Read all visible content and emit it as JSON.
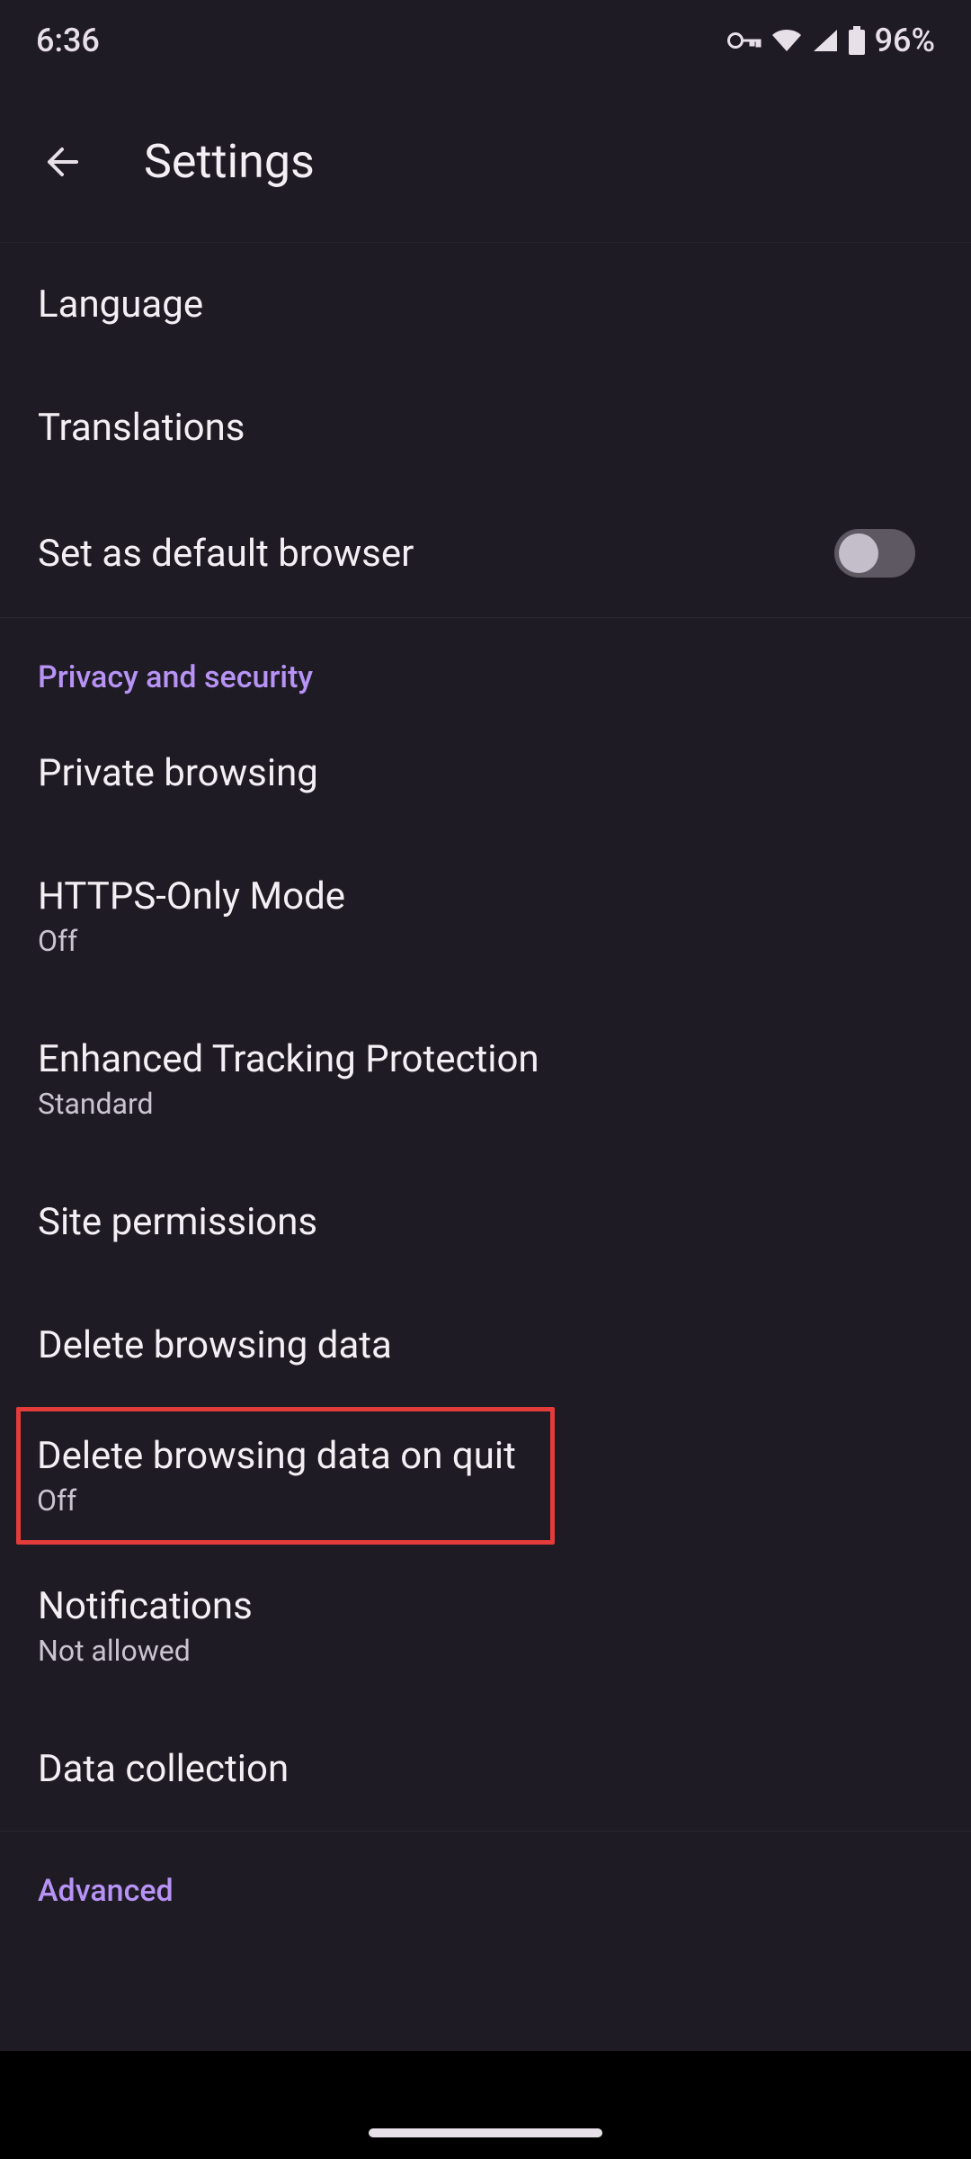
{
  "status": {
    "time": "6:36",
    "battery": "96%"
  },
  "header": {
    "title": "Settings"
  },
  "general": {
    "language": "Language",
    "translations": "Translations",
    "default_browser": "Set as default browser"
  },
  "privacy": {
    "header": "Privacy and security",
    "private_browsing": "Private browsing",
    "https_only": {
      "title": "HTTPS-Only Mode",
      "sub": "Off"
    },
    "etp": {
      "title": "Enhanced Tracking Protection",
      "sub": "Standard"
    },
    "site_permissions": "Site permissions",
    "delete_browsing": "Delete browsing data",
    "delete_on_quit": {
      "title": "Delete browsing data on quit",
      "sub": "Off"
    },
    "notifications": {
      "title": "Notifications",
      "sub": "Not allowed"
    },
    "data_collection": "Data collection"
  },
  "advanced": {
    "header": "Advanced"
  }
}
